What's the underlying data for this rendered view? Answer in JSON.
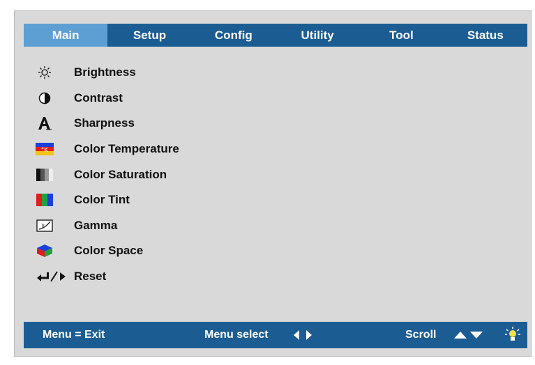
{
  "tabs": [
    {
      "label": "Main",
      "active": true
    },
    {
      "label": "Setup",
      "active": false
    },
    {
      "label": "Config",
      "active": false
    },
    {
      "label": "Utility",
      "active": false
    },
    {
      "label": "Tool",
      "active": false
    },
    {
      "label": "Status",
      "active": false
    }
  ],
  "menu": {
    "items": [
      {
        "label": "Brightness",
        "icon": "brightness-icon"
      },
      {
        "label": "Contrast",
        "icon": "contrast-icon"
      },
      {
        "label": "Sharpness",
        "icon": "sharpness-icon"
      },
      {
        "label": "Color Temperature",
        "icon": "color-temperature-icon"
      },
      {
        "label": "Color Saturation",
        "icon": "color-saturation-icon"
      },
      {
        "label": "Color Tint",
        "icon": "color-tint-icon"
      },
      {
        "label": "Gamma",
        "icon": "gamma-icon"
      },
      {
        "label": "Color Space",
        "icon": "color-space-icon"
      },
      {
        "label": "Reset",
        "icon": "reset-icon"
      }
    ]
  },
  "footer": {
    "exit_label": "Menu = Exit",
    "select_label": "Menu select",
    "select_icon": "left-right-arrows-icon",
    "scroll_label": "Scroll",
    "scroll_icon": "up-down-arrows-icon",
    "bulb_icon": "lamp-icon"
  },
  "colors": {
    "bar": "#1b5d93",
    "active_tab": "#5d9fd2",
    "panel": "#d9d9d9"
  }
}
